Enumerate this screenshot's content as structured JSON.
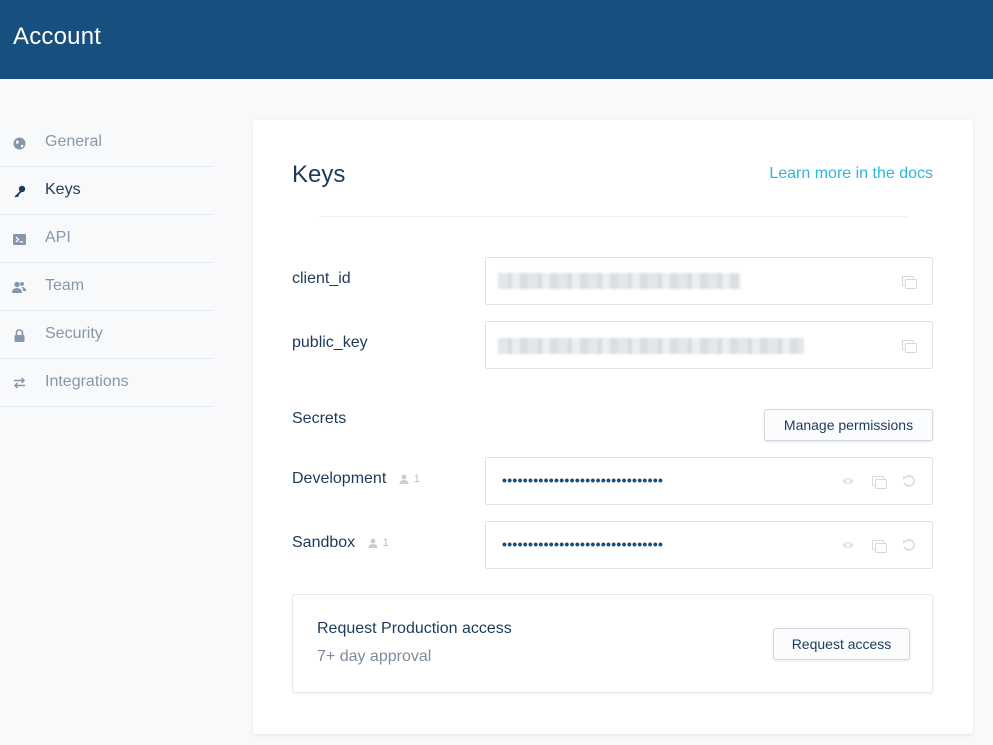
{
  "header": {
    "title": "Account"
  },
  "sidebar": {
    "items": [
      {
        "label": "General",
        "icon": "globe-icon"
      },
      {
        "label": "Keys",
        "icon": "key-icon",
        "active": true
      },
      {
        "label": "API",
        "icon": "terminal-icon"
      },
      {
        "label": "Team",
        "icon": "team-icon"
      },
      {
        "label": "Security",
        "icon": "lock-icon"
      },
      {
        "label": "Integrations",
        "icon": "swap-arrows-icon"
      }
    ]
  },
  "keys": {
    "title": "Keys",
    "docs_link": "Learn more in the docs",
    "client_id_label": "client_id",
    "public_key_label": "public_key",
    "secrets_label": "Secrets",
    "manage_permissions_label": "Manage permissions",
    "secrets": [
      {
        "label": "Development",
        "user_count": "1",
        "value": "•••••••••••••••••••••••••••••••"
      },
      {
        "label": "Sandbox",
        "user_count": "1",
        "value": "•••••••••••••••••••••••••••••••"
      }
    ],
    "production": {
      "title": "Request Production access",
      "subtitle": "7+ day approval",
      "button_label": "Request access"
    }
  },
  "colors": {
    "header_bg": "#174f7f",
    "link": "#2fb6dc",
    "text_primary": "#1e3a5a",
    "text_muted": "#8797aa"
  }
}
